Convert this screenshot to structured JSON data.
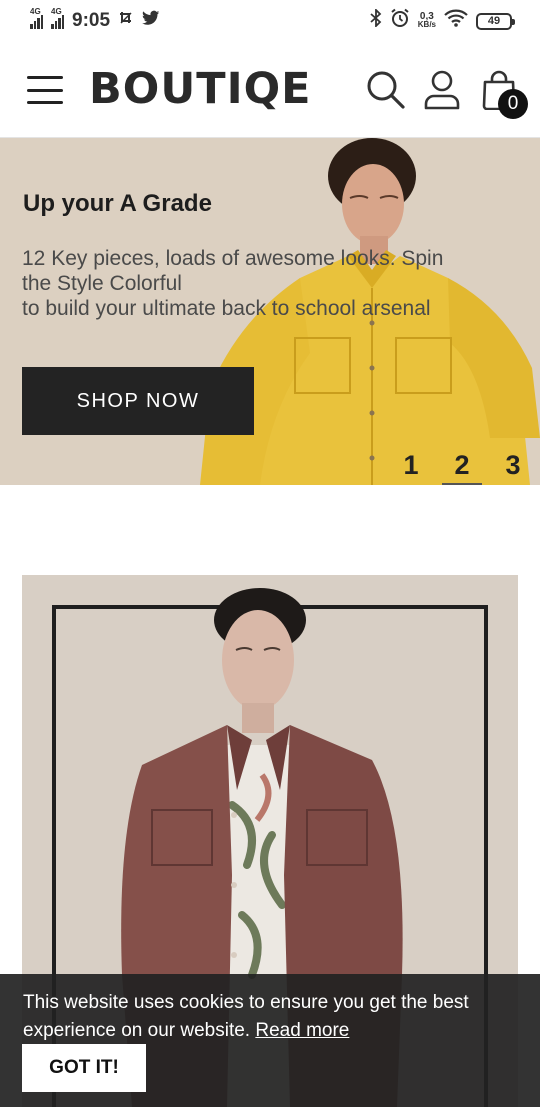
{
  "status_bar": {
    "network_1": "4G",
    "network_2": "4G",
    "time": "9:05",
    "speed_value": "0,3",
    "speed_unit": "KB/s",
    "battery": "49"
  },
  "header": {
    "logo": "BOUTIQE",
    "cart_count": "0"
  },
  "hero": {
    "title": "Up your A Grade",
    "text_lines": [
      "12 Key pieces, loads of awesome looks. Spin",
      "the Style Colorful",
      "to build your ultimate back to school arsenal"
    ],
    "cta_label": "SHOP NOW",
    "slides": [
      "1",
      "2",
      "3"
    ],
    "active_slide": 2,
    "background_color": "#dcd0c1"
  },
  "cookie_banner": {
    "text": "This website uses cookies to ensure you get the best experience on our website.",
    "link_label": "Read more",
    "button_label": "GOT IT!"
  },
  "icons": [
    "menu-icon",
    "search-icon",
    "user-icon",
    "shopping-bag-icon",
    "bluetooth-icon",
    "alarm-icon",
    "wifi-icon",
    "screenshot-icon",
    "twitter-icon"
  ]
}
